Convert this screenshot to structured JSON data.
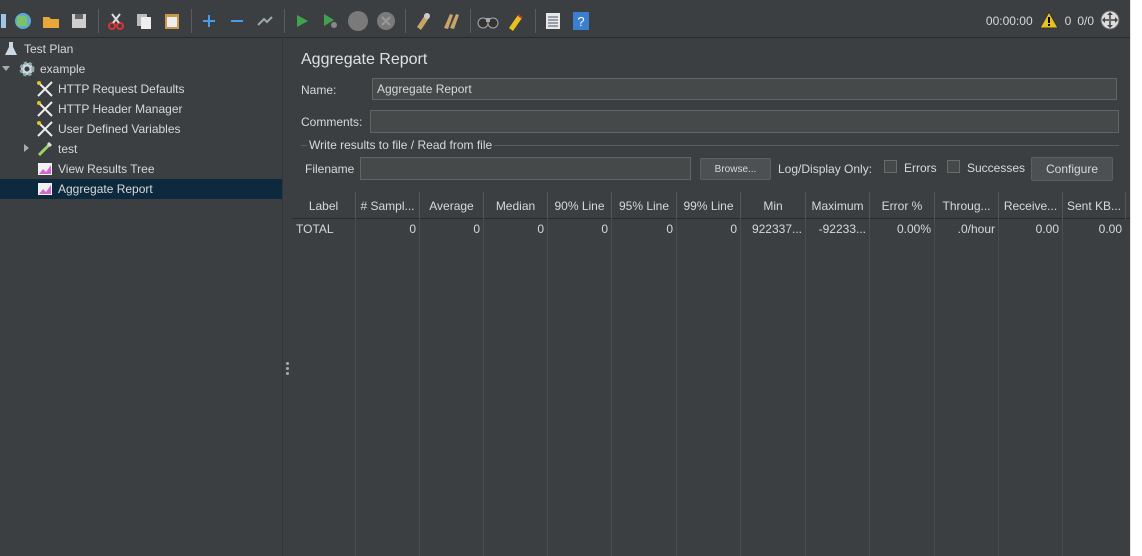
{
  "toolbar": {
    "icons": [
      "templates-icon",
      "new-plan-icon",
      "open-icon",
      "save-icon",
      "cut-icon",
      "copy-icon",
      "paste-icon",
      "expand-icon",
      "collapse-icon",
      "toggle-icon",
      "start-icon",
      "start-no-pause-icon",
      "stop-icon",
      "shutdown-icon",
      "clear-icon",
      "clear-all-icon",
      "search-icon",
      "reset-search-icon",
      "function-helper-icon",
      "help-icon"
    ],
    "elapsed": "00:00:00",
    "warnings": "0",
    "threads": "0/0"
  },
  "tree": {
    "items": [
      {
        "label": "Test Plan",
        "icon": "test-plan-icon"
      },
      {
        "label": "example",
        "icon": "thread-group-gear-icon"
      },
      {
        "label": "HTTP Request Defaults",
        "icon": "config-wrench-icon"
      },
      {
        "label": "HTTP Header Manager",
        "icon": "config-wrench-icon"
      },
      {
        "label": "User Defined Variables",
        "icon": "config-wrench-icon"
      },
      {
        "label": "test",
        "icon": "sampler-pipette-icon"
      },
      {
        "label": "View Results Tree",
        "icon": "listener-chart-icon"
      },
      {
        "label": "Aggregate Report",
        "icon": "listener-chart-icon"
      }
    ]
  },
  "main": {
    "title": "Aggregate Report",
    "name_label": "Name:",
    "name_value": "Aggregate Report",
    "comments_label": "Comments:",
    "comments_value": "",
    "file_group_title": "Write results to file / Read from file",
    "filename_label": "Filename",
    "filename_value": "",
    "browse_label": "Browse...",
    "log_display_label": "Log/Display Only:",
    "errors_label": "Errors",
    "successes_label": "Successes",
    "configure_label": "Configure"
  },
  "table": {
    "headers": [
      "Label",
      "# Sampl...",
      "Average",
      "Median",
      "90% Line",
      "95% Line",
      "99% Line",
      "Min",
      "Maximum",
      "Error %",
      "Throug...",
      "Receive...",
      "Sent KB..."
    ],
    "rows": [
      [
        "TOTAL",
        "0",
        "0",
        "0",
        "0",
        "0",
        "0",
        "922337...",
        "-92233...",
        "0.00%",
        ".0/hour",
        "0.00",
        "0.00"
      ]
    ]
  },
  "colors": {
    "background": "#3c3f41",
    "selection": "#0d293e",
    "field": "#45494a",
    "text": "#d8d8d8",
    "start_green": "#3fa34d",
    "warning_yellow": "#e8c21c"
  }
}
